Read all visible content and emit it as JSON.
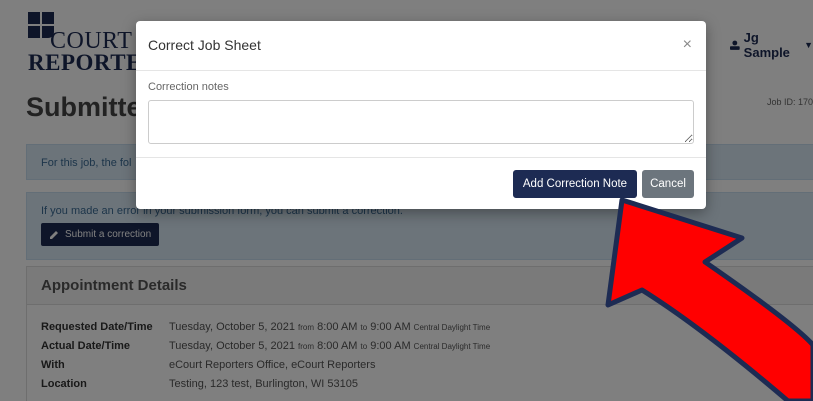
{
  "header": {
    "logo_line1": "COURT",
    "logo_line2": "REPORTER",
    "user_name": "Jg Sample"
  },
  "page": {
    "title": "Submitted",
    "job_id": "Job ID: 170",
    "alert1_text": "For this job, the fol",
    "alert2_text": "If you made an error in your submission form, you can submit a correction.",
    "submit_correction_label": "Submit a correction"
  },
  "appointment": {
    "heading": "Appointment Details",
    "rows": [
      {
        "label": "Requested Date/Time",
        "value": "Tuesday, October 5, 2021",
        "from": "from",
        "start": "8:00 AM",
        "to": "to",
        "end": "9:00 AM",
        "tz": "Central Daylight Time"
      },
      {
        "label": "Actual Date/Time",
        "value": "Tuesday, October 5, 2021",
        "from": "from",
        "start": "8:00 AM",
        "to": "to",
        "end": "9:00 AM",
        "tz": "Central Daylight Time"
      },
      {
        "label": "With",
        "value": "eCourt Reporters Office, eCourt Reporters"
      },
      {
        "label": "Location",
        "value": "Testing, 123 test, Burlington, WI 53105"
      }
    ]
  },
  "modal": {
    "title": "Correct Job Sheet",
    "close_glyph": "×",
    "notes_label": "Correction notes",
    "notes_value": "",
    "add_label": "Add Correction Note",
    "cancel_label": "Cancel"
  },
  "colors": {
    "brand": "#1d2b53",
    "alert_bg": "#d9e8f5",
    "cancel": "#6c757d",
    "arrow_fill": "#ff0000",
    "arrow_stroke": "#1d2b53"
  }
}
